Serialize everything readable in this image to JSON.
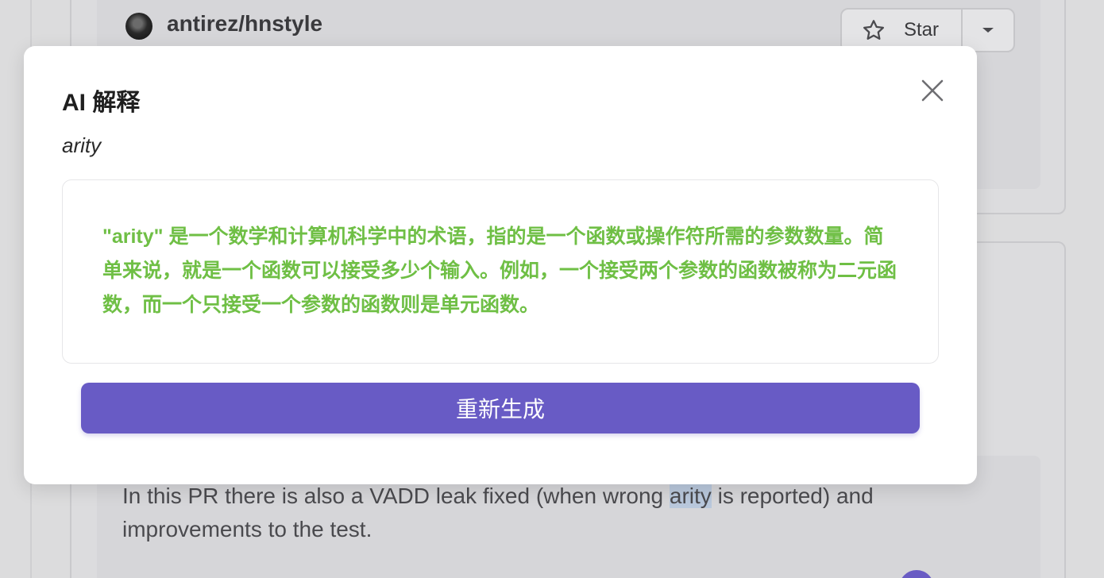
{
  "background": {
    "repo": {
      "name": "antirez/hnstyle"
    },
    "star_button": {
      "label": "Star"
    },
    "comment": {
      "text_before": "In this PR there is also a VADD leak fixed (when wrong ",
      "highlight": "arity",
      "text_after": " is reported) and improvements to the test."
    }
  },
  "modal": {
    "title": "AI 解释",
    "term": "arity",
    "explanation": "\"arity\" 是一个数学和计算机科学中的术语，指的是一个函数或操作符所需的参数数量。简单来说，就是一个函数可以接受多少个输入。例如，一个接受两个参数的函数被称为二元函数，而一个只接受一个参数的函数则是单元函数。",
    "regenerate_label": "重新生成"
  },
  "colors": {
    "accent": "#685bc5",
    "explanation_text": "#6fbf45",
    "highlight": "#b9c8dc"
  }
}
